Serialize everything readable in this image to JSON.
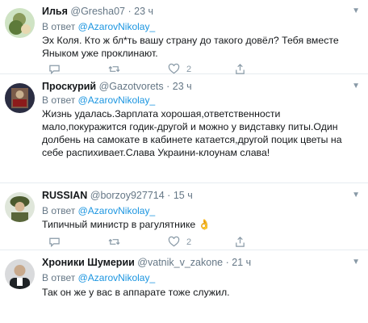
{
  "tweets": [
    {
      "name": "Илья",
      "handle": "@Gresha07",
      "time": "23 ч",
      "reply_prefix": "В ответ",
      "reply_to": "@AzarovNikolay_",
      "text": "Эх Коля. Кто ж бл*ть вашу страну до такого довёл? Тебя вместе Яныком уже проклинают.",
      "likes": "2"
    },
    {
      "name": "Проскурий",
      "handle": "@Gazotvorets",
      "time": "23 ч",
      "reply_prefix": "В ответ",
      "reply_to": "@AzarovNikolay_",
      "text": "Жизнь удалась.Зарплата хорошая,ответственности мало,покуражится годик-другой и можно у видставку питы.Один долбень на самокате в кабинете катается,другой поцик цветы на себе распихивает.Слава Украини-клоунам слава!"
    },
    {
      "name": "RUSSIAN",
      "handle": "@borzoy927714",
      "time": "15 ч",
      "reply_prefix": "В ответ",
      "reply_to": "@AzarovNikolay_",
      "text": "Типичный министр в рагулятнике 👌",
      "likes": "2"
    },
    {
      "name": "Хроники Шумерии",
      "handle": "@vatnik_v_zakone",
      "time": "21 ч",
      "reply_prefix": "В ответ",
      "reply_to": "@AzarovNikolay_",
      "text": "Так он же у вас в аппарате тоже служил."
    }
  ],
  "icons": {
    "reply": "reply-icon",
    "retweet": "retweet-icon",
    "like": "like-icon",
    "share": "share-icon",
    "caret": "chevron-down-icon"
  }
}
